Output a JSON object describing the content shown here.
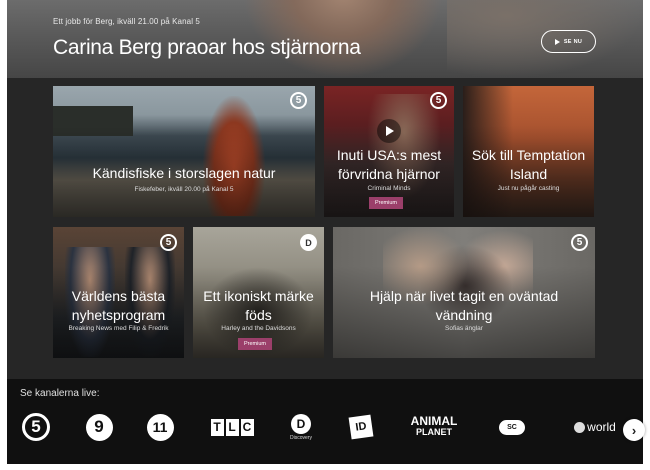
{
  "hero": {
    "kicker": "Ett jobb för Berg, ikväll 21.00 på Kanal 5",
    "title": "Carina Berg praoar hos stjärnorna",
    "see_now_label": "SE NU"
  },
  "tiles": [
    {
      "title": "Kändisfiske i storslagen natur",
      "subtitle": "Fiskefeber, ikväll 20.00 på Kanal 5",
      "channel_badge": "5"
    },
    {
      "title": "Inuti USA:s mest förvridna hjärnor",
      "subtitle": "Criminal Minds",
      "channel_badge": "5",
      "premium": "Premium"
    },
    {
      "title": "Sök till Temptation Island",
      "subtitle": "Just nu pågår casting"
    },
    {
      "title": "Världens bästa nyhetsprogram",
      "subtitle": "Breaking News med Filip & Fredrik",
      "channel_badge": "5"
    },
    {
      "title": "Ett ikoniskt märke föds",
      "subtitle": "Harley and the Davidsons",
      "channel_badge": "D",
      "premium": "Premium"
    },
    {
      "title": "Hjälp när livet tagit en oväntad vändning",
      "subtitle": "Sofias änglar",
      "channel_badge": "5"
    }
  ],
  "channels": {
    "label": "Se kanalerna live:",
    "items": [
      {
        "name": "Kanal 5",
        "glyph": "5"
      },
      {
        "name": "Kanal 9",
        "glyph": "9"
      },
      {
        "name": "Kanal 11",
        "glyph": "11"
      },
      {
        "name": "TLC",
        "letters": [
          "T",
          "L",
          "C"
        ]
      },
      {
        "name": "Discovery",
        "glyph": "D",
        "caption": "Discovery"
      },
      {
        "name": "Investigation Discovery",
        "glyph": "ID"
      },
      {
        "name": "Animal Planet",
        "line1": "ANIMAL",
        "line2": "PLANET"
      },
      {
        "name": "Eurosport",
        "glyph": "SC"
      },
      {
        "name": "Discovery World",
        "text": "world"
      }
    ],
    "next_icon": "chevron-right-icon"
  },
  "colors": {
    "premium": "#9b3f6a",
    "page_bg": "#262626",
    "channel_bar_bg": "#101010"
  }
}
